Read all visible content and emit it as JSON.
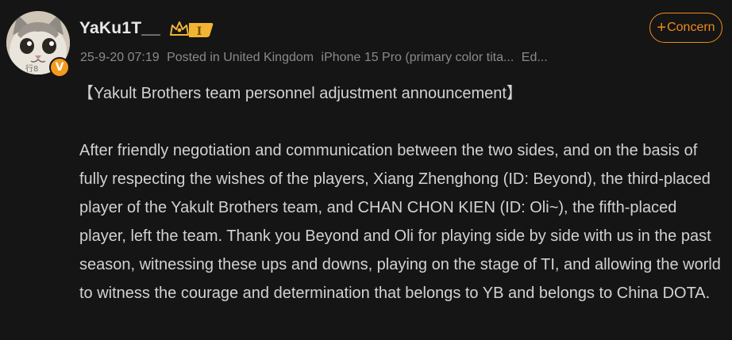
{
  "post": {
    "author": {
      "name": "YaKu1T__",
      "avatar_label": "行8",
      "verified_mark": "V",
      "vip_level": "I"
    },
    "follow_label": "Concern",
    "follow_plus": "+",
    "meta": {
      "time": "25-9-20 07:19",
      "location": "Posted in United Kingdom",
      "device": "iPhone 15 Pro (primary color tita...",
      "edit": "Ed..."
    },
    "headline": "【Yakult Brothers team personnel adjustment announcement】",
    "body": "After friendly negotiation and communication between the two sides, and on the basis of fully respecting the wishes of the players, Xiang Zhenghong (ID: Beyond), the third-placed player of the Yakult Brothers team, and CHAN CHON KIEN (ID: Oli~), the fifth-placed player, left the team. Thank you Beyond and Oli for playing side by side with us in the past season, witnessing these ups and downs, playing on the stage of TI, and allowing the world to witness the courage and determination that belongs to YB and belongs to China DOTA."
  },
  "colors": {
    "background": "#151515",
    "accent": "#f08a1a",
    "text": "#d2d2d2",
    "meta": "#8a8a8a",
    "badge": "#f39a1e"
  }
}
